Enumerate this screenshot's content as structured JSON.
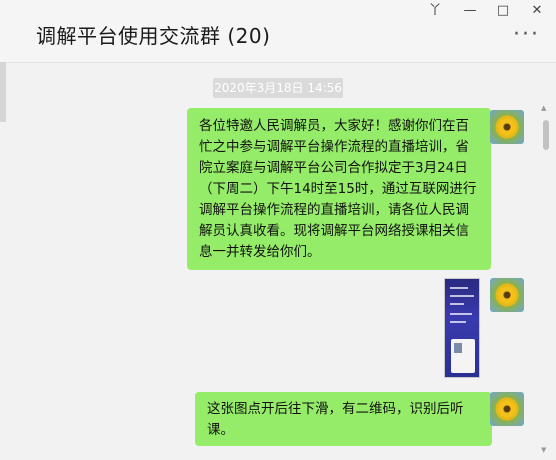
{
  "window": {
    "title": "调解平台使用交流群 (20)",
    "pin_icon": "pin-icon",
    "minimize_icon": "minimize-icon",
    "maximize_icon": "maximize-icon",
    "close_icon": "close-icon",
    "more_icon": "more-icon"
  },
  "chat": {
    "timestamp": "2020年3月18日 14:56",
    "messages": [
      {
        "type": "text",
        "text": "各位特邀人民调解员，大家好！感谢你们在百忙之中参与调解平台操作流程的直播培训，省院立案庭与调解平台公司合作拟定于3月24日（下周二）下午14时至15时，通过互联网进行调解平台操作流程的直播培训，请各位人民调解员认真收看。现将调解平台网络授课相关信息一并转发给你们。"
      },
      {
        "type": "image",
        "icon": "image-thumbnail"
      },
      {
        "type": "text",
        "text": "这张图点开后往下滑，有二维码，识别后听课。"
      }
    ]
  },
  "colors": {
    "bubble": "#95ec69",
    "background": "#f2f2f2",
    "timestamp_bg": "#dadada"
  }
}
